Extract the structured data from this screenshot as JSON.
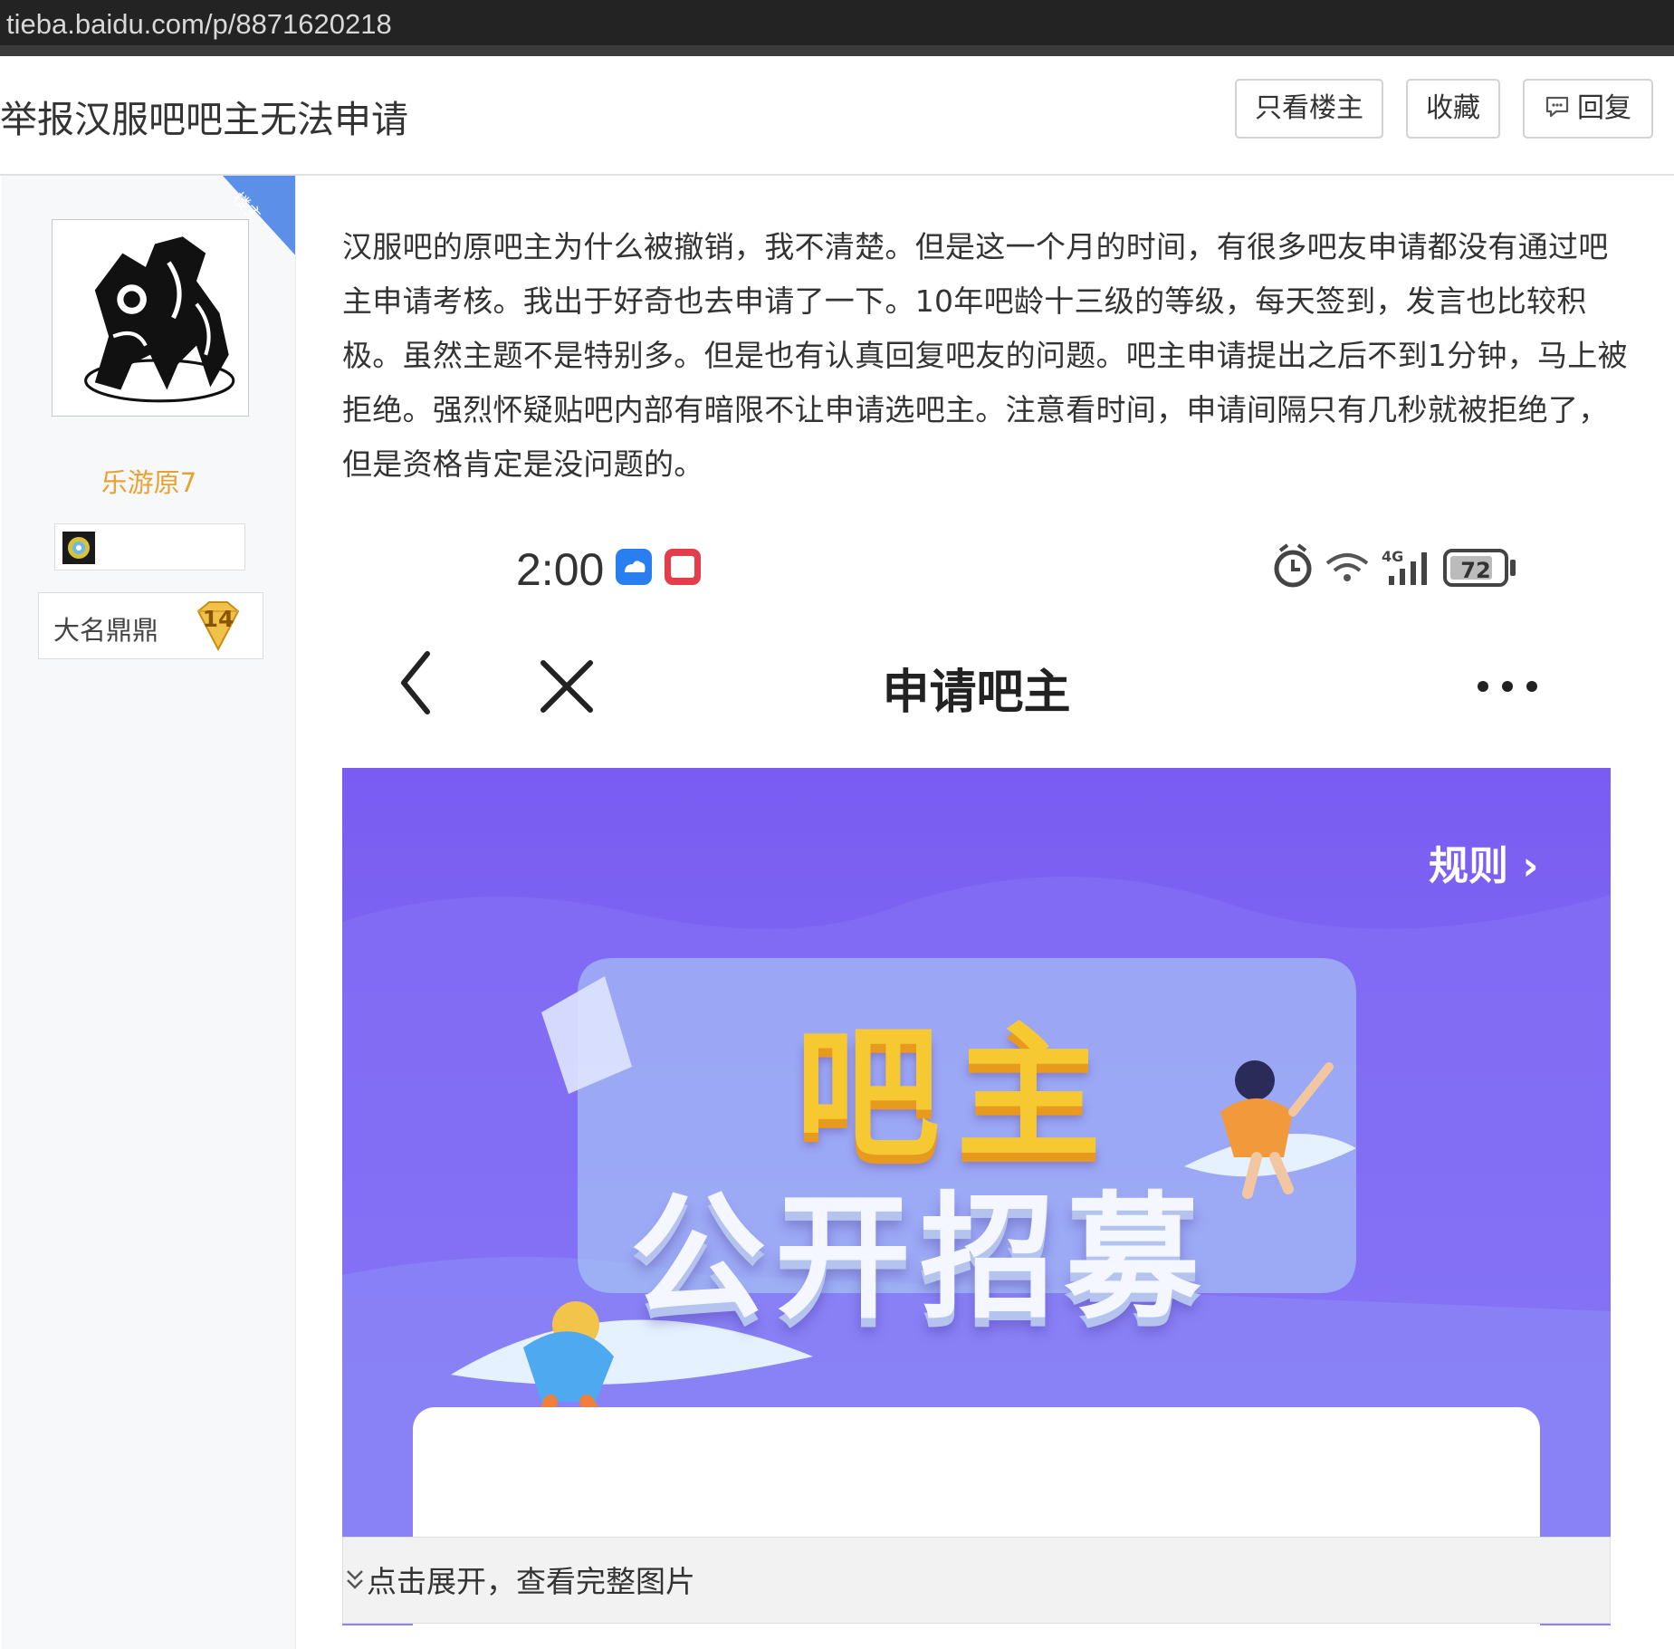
{
  "browser": {
    "url": "tieba.baidu.com/p/8871620218"
  },
  "header": {
    "title": "举报汉服吧吧主无法申请",
    "only_op_label": "只看楼主",
    "favorite_label": "收藏",
    "reply_label": "回复"
  },
  "author": {
    "op_tag": "楼主",
    "name": "乐游原7",
    "level_title": "大名鼎鼎",
    "level": "14"
  },
  "post": {
    "text": "汉服吧的原吧主为什么被撤销，我不清楚。但是这一个月的时间，有很多吧友申请都没有通过吧主申请考核。我出于好奇也去申请了一下。10年吧龄十三级的等级，每天签到，发言也比较积极。虽然主题不是特别多。但是也有认真回复吧友的问题。吧主申请提出之后不到1分钟，马上被拒绝。强烈怀疑贴吧内部有暗限不让申请选吧主。注意看时间，申请间隔只有几秒就被拒绝了，但是资格肯定是没问题的。"
  },
  "screenshot": {
    "time": "2:00",
    "network": "4G",
    "battery": "72",
    "page_title": "申请吧主",
    "rule_label": "规则 ›",
    "hero_line1": "吧主",
    "hero_line2": "公开招募"
  },
  "expand": {
    "label": "点击展开，查看完整图片"
  },
  "colors": {
    "username": "#e8a231",
    "op_tag_bg": "#5b8fe8",
    "banner_purple": "#7a5cf2"
  }
}
